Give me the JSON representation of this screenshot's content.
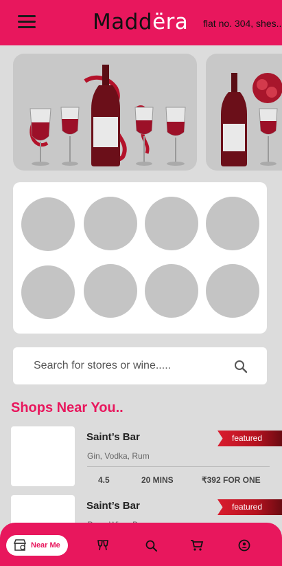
{
  "header": {
    "brand_dark": "Madd",
    "brand_light": "ëra",
    "address": "flat no. 304, shes..."
  },
  "search": {
    "placeholder": "Search for stores or wine....."
  },
  "section": {
    "title": "Shops Near You.."
  },
  "shops": [
    {
      "name": "Saint’s Bar",
      "tags": "Gin, Vodka, Rum",
      "badge": "featured",
      "rating": "4.5",
      "time": "20 MINS",
      "price": "₹392 FOR ONE"
    },
    {
      "name": "Saint’s Bar",
      "tags": "Rum, Wine, Beer",
      "badge": "featured"
    }
  ],
  "bottom_nav": {
    "active_label": "Near Me",
    "items": [
      "store-icon",
      "cheers-icon",
      "search-icon",
      "cart-icon",
      "profile-icon"
    ]
  },
  "colors": {
    "primary": "#e8175d",
    "badge": "#c4161c",
    "placeholder": "#c4c4c4"
  }
}
